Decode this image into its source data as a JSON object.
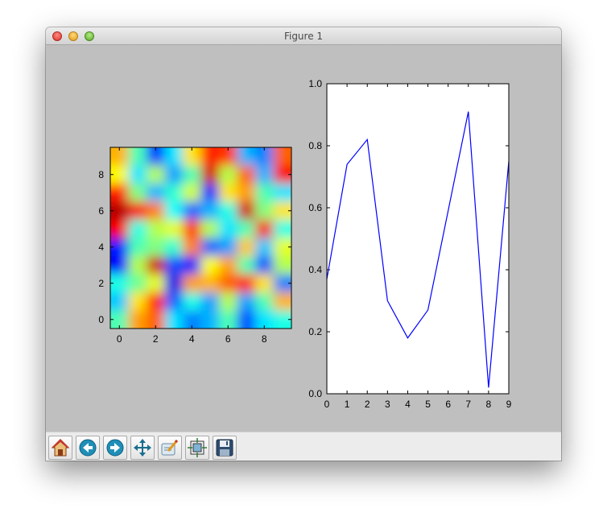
{
  "window": {
    "title": "Figure 1"
  },
  "toolbar": {
    "buttons": [
      {
        "name": "home",
        "icon": "home-icon"
      },
      {
        "name": "back",
        "icon": "back-arrow-icon"
      },
      {
        "name": "forward",
        "icon": "forward-arrow-icon"
      },
      {
        "name": "pan",
        "icon": "pan-move-icon"
      },
      {
        "name": "zoom",
        "icon": "zoom-rect-icon"
      },
      {
        "name": "subplots",
        "icon": "subplots-config-icon"
      },
      {
        "name": "save",
        "icon": "save-disk-icon"
      }
    ]
  },
  "colors": {
    "line": "#0000ff",
    "canvas_bg": "#bfbfbf",
    "axes_bg": "#ffffff"
  },
  "chart_data": [
    {
      "type": "heatmap",
      "title": "",
      "colormap": "jet",
      "xlim": [
        -0.5,
        9.5
      ],
      "ylim": [
        9.5,
        -0.5
      ],
      "xticks": [
        0,
        2,
        4,
        6,
        8
      ],
      "yticks": [
        0,
        2,
        4,
        6,
        8
      ],
      "values": [
        [
          0.7,
          0.45,
          0.18,
          0.35,
          0.65,
          0.85,
          0.82,
          0.3,
          0.25,
          0.78
        ],
        [
          0.62,
          0.35,
          0.55,
          0.28,
          0.45,
          0.92,
          0.55,
          0.78,
          0.3,
          0.88
        ],
        [
          0.85,
          0.5,
          0.3,
          0.42,
          0.58,
          0.15,
          0.65,
          0.72,
          0.45,
          0.35
        ],
        [
          0.95,
          0.88,
          0.75,
          0.38,
          0.22,
          0.3,
          0.4,
          0.92,
          0.5,
          0.65
        ],
        [
          0.88,
          0.4,
          0.55,
          0.6,
          0.82,
          0.55,
          0.35,
          0.45,
          0.88,
          0.4
        ],
        [
          0.15,
          0.45,
          0.5,
          0.42,
          0.75,
          0.22,
          0.28,
          0.68,
          0.32,
          0.6
        ],
        [
          0.12,
          0.55,
          0.92,
          0.2,
          0.15,
          0.62,
          0.72,
          0.45,
          0.2,
          0.55
        ],
        [
          0.4,
          0.48,
          0.6,
          0.1,
          0.72,
          0.7,
          0.78,
          0.85,
          0.65,
          0.25
        ],
        [
          0.32,
          0.65,
          0.85,
          0.22,
          0.4,
          0.28,
          0.55,
          0.28,
          0.45,
          0.7
        ],
        [
          0.45,
          0.72,
          0.78,
          0.35,
          0.25,
          0.3,
          0.45,
          0.2,
          0.35,
          0.4
        ]
      ]
    },
    {
      "type": "line",
      "title": "",
      "xlabel": "",
      "ylabel": "",
      "x": [
        0,
        1,
        2,
        3,
        4,
        5,
        6,
        7,
        8,
        9
      ],
      "y": [
        0.37,
        0.74,
        0.82,
        0.3,
        0.18,
        0.27,
        0.59,
        0.91,
        0.02,
        0.75
      ],
      "xlim": [
        0,
        9
      ],
      "ylim": [
        0,
        1.0
      ],
      "xticks": [
        "0",
        "1",
        "2",
        "3",
        "4",
        "5",
        "6",
        "7",
        "8",
        "9"
      ],
      "yticks": [
        "0.0",
        "0.2",
        "0.4",
        "0.6",
        "0.8",
        "1.0"
      ],
      "grid": false,
      "color": "#0000ff"
    }
  ]
}
